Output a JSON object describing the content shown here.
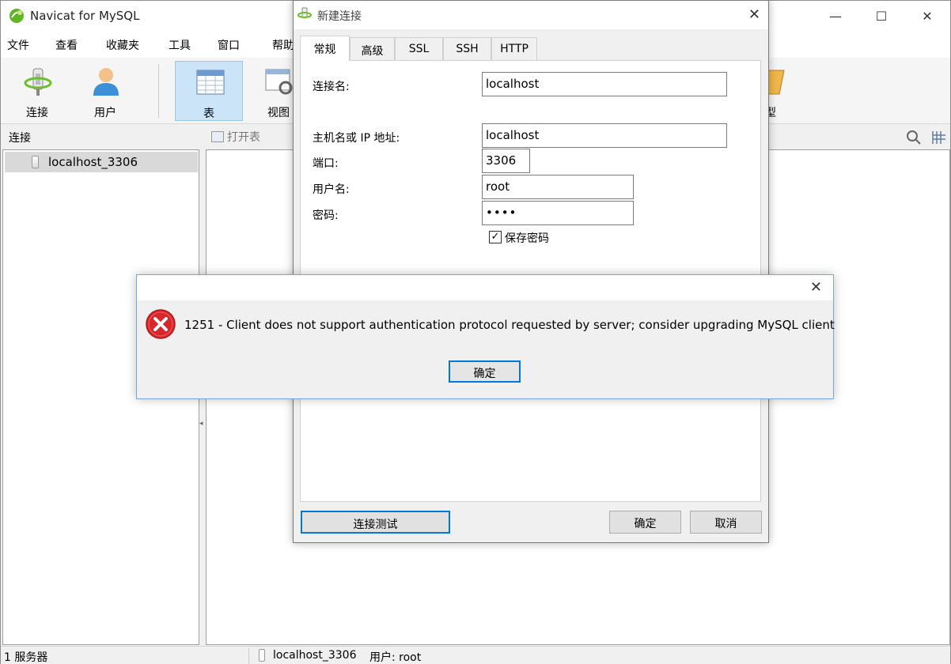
{
  "app": {
    "title": "Navicat for MySQL"
  },
  "window_controls": {
    "minimize": "—",
    "maximize": "☐",
    "close": "✕"
  },
  "menu": [
    "文件",
    "查看",
    "收藏夹",
    "工具",
    "窗口",
    "帮助"
  ],
  "toolbar": {
    "items": [
      {
        "label": "连接",
        "icon": "connection-icon"
      },
      {
        "label": "用户",
        "icon": "user-icon"
      },
      {
        "label": "表",
        "icon": "table-icon",
        "active": true
      },
      {
        "label": "视图",
        "icon": "view-icon"
      },
      {
        "label": "型",
        "icon": "model-icon"
      }
    ]
  },
  "subbar": {
    "label": "连接",
    "open_table": "打开表"
  },
  "tree": {
    "items": [
      {
        "label": "localhost_3306"
      }
    ]
  },
  "statusbar": {
    "servers": "1 服务器",
    "connection": "localhost_3306",
    "user": "用户: root"
  },
  "new_connection_dialog": {
    "title": "新建连接",
    "tabs": [
      "常规",
      "高级",
      "SSL",
      "SSH",
      "HTTP"
    ],
    "active_tab": "常规",
    "fields": {
      "connection_name": {
        "label": "连接名:",
        "value": "localhost"
      },
      "host": {
        "label": "主机名或 IP 地址:",
        "value": "localhost"
      },
      "port": {
        "label": "端口:",
        "value": "3306"
      },
      "username": {
        "label": "用户名:",
        "value": "root"
      },
      "password": {
        "label": "密码:",
        "value": "••••"
      }
    },
    "save_password": {
      "label": "保存密码",
      "checked": true
    },
    "buttons": {
      "test": "连接测试",
      "ok": "确定",
      "cancel": "取消"
    }
  },
  "error_dialog": {
    "message": "1251 - Client does not support authentication protocol requested by server; consider upgrading MySQL client",
    "ok": "确定",
    "close": "✕"
  },
  "colors": {
    "accent": "#0078d7",
    "active_tool_bg": "#cce4f7",
    "error_red": "#d9262a"
  }
}
